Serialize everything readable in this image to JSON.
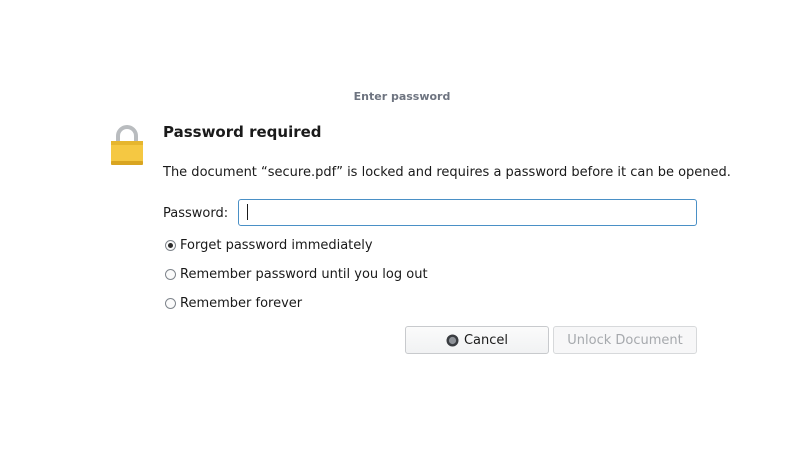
{
  "window": {
    "title": "Enter password"
  },
  "icons": {
    "lock": "lock-icon",
    "cancel": "cancel-icon"
  },
  "dialog": {
    "heading": "Password required",
    "message": "The document “secure.pdf” is locked and requires a password before it can be opened.",
    "password_label": "Password:",
    "password_value": "",
    "password_placeholder": ""
  },
  "options": [
    {
      "label": "Forget password immediately",
      "checked": true
    },
    {
      "label": "Remember password until you log out",
      "checked": false
    },
    {
      "label": "Remember forever",
      "checked": false
    }
  ],
  "buttons": {
    "cancel_label": "Cancel",
    "unlock_label": "Unlock Document",
    "unlock_enabled": false
  },
  "colors": {
    "accent_border": "#4a90c6",
    "lock_body": "#f5c842",
    "lock_shackle": "#b9bcbf",
    "disabled_text": "#a6a9ad"
  }
}
